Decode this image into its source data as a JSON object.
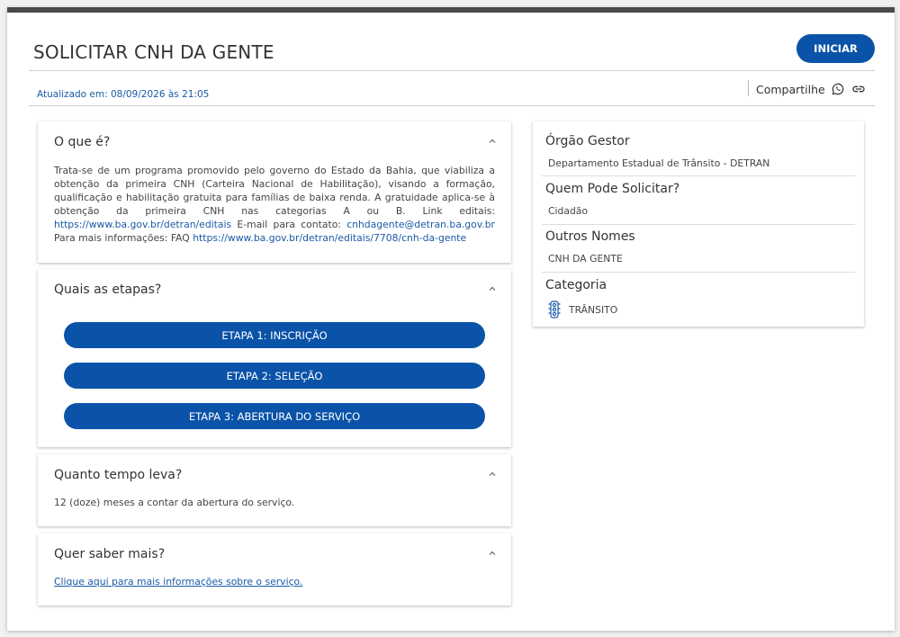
{
  "header": {
    "title": "SOLICITAR CNH DA GENTE",
    "start_label": "INICIAR",
    "updated": "Atualizado em: 08/09/2026 às 21:05",
    "share_label": "Compartilhe"
  },
  "sections": {
    "o_que_e": {
      "title": "O que é?",
      "text_1": "Trata-se de um programa promovido pelo governo do Estado da Bahia, que viabiliza a obtenção da primeira CNH (Carteira Nacional de Habilitação), visando a formação, qualificação e habilitação gratuita para famílias de baixa renda. A gratuidade aplica-se à obtenção da primeira CNH nas categorias A ou B. Link editais: ",
      "link_editais": "https://www.ba.gov.br/detran/editais",
      "text_2": " E-mail para contato: ",
      "email": "cnhdagente@detran.ba.gov.br",
      "text_3": " Para mais informações: FAQ ",
      "link_faq": "https://www.ba.gov.br/detran/editais/7708/cnh-da-gente"
    },
    "etapas": {
      "title": "Quais as etapas?",
      "steps": [
        "ETAPA 1: INSCRIÇÃO",
        "ETAPA 2: SELEÇÃO",
        "ETAPA 3: ABERTURA DO SERVIÇO"
      ]
    },
    "tempo": {
      "title": "Quanto tempo leva?",
      "text": "12 (doze) meses a contar da abertura do serviço."
    },
    "saber_mais": {
      "title": "Quer saber mais?",
      "link": "Clique aqui para mais informações sobre o serviço."
    }
  },
  "sidebar": {
    "orgao_title": "Órgão Gestor",
    "orgao_value": "Departamento Estadual de Trânsito - DETRAN",
    "quem_title": "Quem Pode Solicitar?",
    "quem_value": "Cidadão",
    "outros_title": "Outros Nomes",
    "outros_value": "CNH DA GENTE",
    "categoria_title": "Categoria",
    "categoria_value": "TRÂNSITO"
  },
  "icons": {
    "whatsapp": "whatsapp-icon",
    "link": "link-icon",
    "chevron": "chevron-up-icon",
    "traffic": "traffic-light-icon"
  },
  "colors": {
    "primary": "#0a53a8",
    "link": "#1a5aa6",
    "top_bar": "#4a4a4a"
  }
}
